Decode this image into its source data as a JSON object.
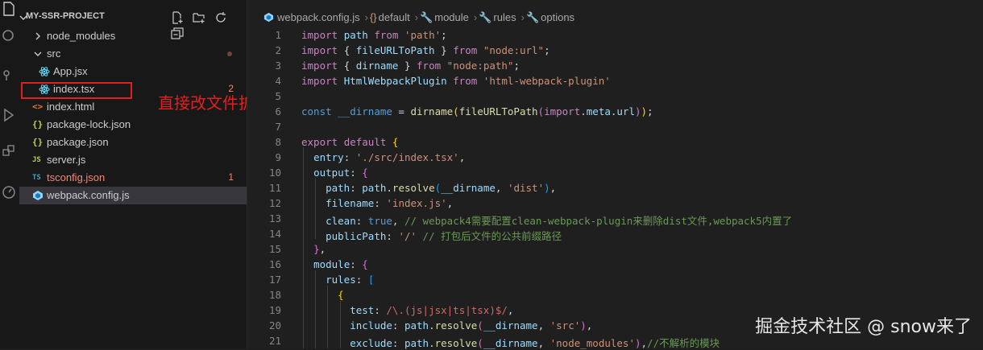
{
  "explorer": {
    "title": "MY-SSR-PROJECT",
    "items": [
      {
        "label": "node_modules",
        "kind": "folder",
        "expanded": false
      },
      {
        "label": "src",
        "kind": "folder",
        "expanded": true,
        "status": "error-dot"
      },
      {
        "label": "App.jsx",
        "kind": "react"
      },
      {
        "label": "index.tsx",
        "kind": "react",
        "badge": "2"
      },
      {
        "label": "index.html",
        "kind": "html"
      },
      {
        "label": "package-lock.json",
        "kind": "json"
      },
      {
        "label": "package.json",
        "kind": "json"
      },
      {
        "label": "server.js",
        "kind": "js"
      },
      {
        "label": "tsconfig.json",
        "kind": "ts",
        "badge": "1"
      },
      {
        "label": "webpack.config.js",
        "kind": "webpack"
      }
    ],
    "icons": {
      "json": "{}",
      "js": "JS",
      "ts": "TS",
      "html": "<>"
    }
  },
  "annotation": {
    "text": "直接改文件扩展名，然后测试"
  },
  "breadcrumbs": [
    "webpack.config.js",
    "default",
    "module",
    "rules",
    "options"
  ],
  "line_numbers": [
    "1",
    "2",
    "3",
    "4",
    "5",
    "6",
    "7",
    "8",
    "9",
    "10",
    "11",
    "12",
    "13",
    "14",
    "15",
    "16",
    "17",
    "18",
    "19",
    "20",
    "21"
  ],
  "code": {
    "t1": [
      "import",
      " ",
      "path",
      " ",
      "from",
      " ",
      "'path'",
      ";"
    ],
    "t2": [
      "import",
      " ",
      "{",
      " ",
      "fileURLToPath",
      " ",
      "}",
      " ",
      "from",
      " ",
      "\"node:url\"",
      ";"
    ],
    "t3": [
      "import",
      " ",
      "{",
      " ",
      "dirname",
      " ",
      "}",
      " ",
      "from",
      " ",
      "\"node:path\"",
      ";"
    ],
    "t4": [
      "import",
      " ",
      "HtmlWebpackPlugin",
      " ",
      "from",
      " ",
      "'html-webpack-plugin'"
    ],
    "t6": [
      "const",
      " ",
      "__dirname",
      " = ",
      "dirname",
      "(",
      "fileURLToPath",
      "(",
      "import",
      ".",
      "meta",
      ".",
      "url",
      ")",
      ")",
      ";"
    ],
    "t8": [
      "export",
      " ",
      "default",
      " ",
      "{"
    ],
    "t9": [
      "  ",
      "entry",
      ": ",
      "'./src/index.tsx'",
      ","
    ],
    "t10": [
      "  ",
      "output",
      ": ",
      "{"
    ],
    "t11": [
      "    ",
      "path",
      ": ",
      "path",
      ".",
      "resolve",
      "(",
      "__dirname",
      ", ",
      "'dist'",
      ")",
      ","
    ],
    "t12": [
      "    ",
      "filename",
      ": ",
      "'index.js'",
      ","
    ],
    "t13": [
      "    ",
      "clean",
      ": ",
      "true",
      ", ",
      "// webpack4需要配置clean-webpack-plugin来删除dist文件,webpack5内置了"
    ],
    "t14": [
      "    ",
      "publicPath",
      ": ",
      "'/'",
      " ",
      "// 打包后文件的公共前缀路径"
    ],
    "t15": [
      "  ",
      "}",
      ","
    ],
    "t16": [
      "  ",
      "module",
      ": ",
      "{"
    ],
    "t17": [
      "    ",
      "rules",
      ": ",
      "["
    ],
    "t18": [
      "      ",
      "{"
    ],
    "t19": [
      "        ",
      "test",
      ": ",
      "/\\.(js|jsx|ts|tsx)$/",
      ","
    ],
    "t20": [
      "        ",
      "include",
      ": ",
      "path",
      ".",
      "resolve",
      "(",
      "__dirname",
      ", ",
      "'src'",
      ")",
      ","
    ],
    "t21": [
      "        ",
      "exclude",
      ": ",
      "path",
      ".",
      "resolve",
      "(",
      "__dirname",
      ", ",
      "'node_modules'",
      ")",
      ",",
      "//不解析的模块"
    ]
  },
  "watermark": "掘金技术社区 @ snow来了",
  "colors": {
    "background": "#1e1e1e",
    "sidebar": "#181818",
    "error": "#f48771",
    "annotation": "#e0201e"
  }
}
